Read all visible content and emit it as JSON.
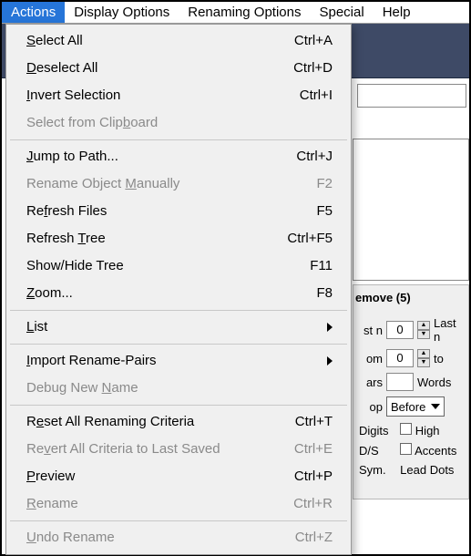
{
  "menubar": {
    "actions": "Actions",
    "display_options": "Display Options",
    "renaming_options": "Renaming Options",
    "special": "Special",
    "help": "Help"
  },
  "menu": {
    "select_all": {
      "label_pre": "",
      "u": "S",
      "label_post": "elect All",
      "shortcut": "Ctrl+A"
    },
    "deselect_all": {
      "label_pre": "",
      "u": "D",
      "label_post": "eselect All",
      "shortcut": "Ctrl+D"
    },
    "invert_selection": {
      "label_pre": "",
      "u": "I",
      "label_post": "nvert Selection",
      "shortcut": "Ctrl+I"
    },
    "select_clipboard": {
      "label_pre": "Select from Clip",
      "u": "b",
      "label_post": "oard",
      "shortcut": ""
    },
    "jump_to_path": {
      "label_pre": "",
      "u": "J",
      "label_post": "ump to Path...",
      "shortcut": "Ctrl+J"
    },
    "rename_manually": {
      "label_pre": "Rename Object ",
      "u": "M",
      "label_post": "anually",
      "shortcut": "F2"
    },
    "refresh_files": {
      "label_pre": "Re",
      "u": "f",
      "label_post": "resh Files",
      "shortcut": "F5"
    },
    "refresh_tree": {
      "label_pre": "Refresh ",
      "u": "T",
      "label_post": "ree",
      "shortcut": "Ctrl+F5"
    },
    "show_hide_tree": {
      "label_pre": "Show/Hide Tree",
      "u": "",
      "label_post": "",
      "shortcut": "F11"
    },
    "zoom": {
      "label_pre": "",
      "u": "Z",
      "label_post": "oom...",
      "shortcut": "F8"
    },
    "list": {
      "label_pre": "",
      "u": "L",
      "label_post": "ist",
      "shortcut": ""
    },
    "import_pairs": {
      "label_pre": "",
      "u": "I",
      "label_post": "mport Rename-Pairs",
      "shortcut": ""
    },
    "debug_new_name": {
      "label_pre": "Debug New ",
      "u": "N",
      "label_post": "ame",
      "shortcut": ""
    },
    "reset_criteria": {
      "label_pre": "R",
      "u": "e",
      "label_post": "set All Renaming Criteria",
      "shortcut": "Ctrl+T"
    },
    "revert_criteria": {
      "label_pre": "Re",
      "u": "v",
      "label_post": "ert All Criteria to Last Saved",
      "shortcut": "Ctrl+E"
    },
    "preview": {
      "label_pre": "",
      "u": "P",
      "label_post": "review",
      "shortcut": "Ctrl+P"
    },
    "rename": {
      "label_pre": "",
      "u": "R",
      "label_post": "ename",
      "shortcut": "Ctrl+R"
    },
    "undo_rename": {
      "label_pre": "",
      "u": "U",
      "label_post": "ndo Rename",
      "shortcut": "Ctrl+Z"
    }
  },
  "panel": {
    "title": "emove (5)",
    "stn": "st n",
    "lastn": "Last n",
    "om": "om",
    "to": "to",
    "ars": "ars",
    "words": "Words",
    "op": "op",
    "before": "Before",
    "digits": "Digits",
    "high": "High",
    "ds": "D/S",
    "accents": "Accents",
    "sym": "Sym.",
    "lead_dots": "Lead Dots",
    "n0a": "0",
    "n0b": "0"
  }
}
